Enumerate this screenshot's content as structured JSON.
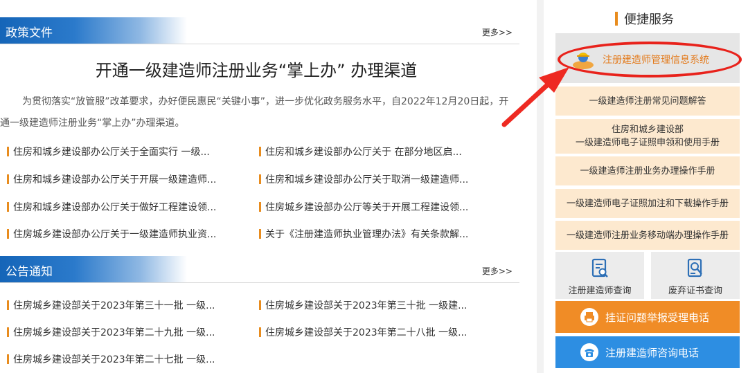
{
  "policy": {
    "section_title": "政策文件",
    "more": "更多>>",
    "headline": "开通一级建造师注册业务“掌上办” 办理渠道",
    "intro": "为贯彻落实“放管服”改革要求，办好便民惠民“关键小事”，进一步优化政务服务水平，自2022年12月20日起，开通一级建造师注册业务“掌上办”办理渠道。",
    "links": [
      "住房和城乡建设部办公厅关于全面实行 一级...",
      "住房和城乡建设部办公厅关于 在部分地区启...",
      "住房和城乡建设部办公厅关于开展一级建造师...",
      "住房和城乡建设部办公厅关于取消一级建造师...",
      "住房和城乡建设部办公厅关于做好工程建设领...",
      "住房城乡建设部办公厅等关于开展工程建设领...",
      "住房城乡建设部办公厅关于一级建造师执业资...",
      "关于《注册建造师执业管理办法》有关条款解..."
    ]
  },
  "notice": {
    "section_title": "公告通知",
    "more": "更多>>",
    "links": [
      "住房城乡建设部关于2023年第三十一批 一级...",
      "住房城乡建设部关于2023年第三十批 一级建...",
      "住房城乡建设部关于2023年第二十九批 一级...",
      "住房城乡建设部关于2023年第二十八批 一级...",
      "住房城乡建设部关于2023年第二十七批 一级..."
    ]
  },
  "sidebar": {
    "title": "便捷服务",
    "system_button": "注册建造师管理信息系统",
    "buttons": [
      "一级建造师注册常见问题解答",
      "住房和城乡建设部",
      "一级建造师电子证照申领和使用手册",
      "一级建造师注册业务办理操作手册",
      "一级建造师电子证照加注和下载操作手册",
      "一级建造师注册业务移动端办理操作手册"
    ],
    "tiles": [
      "注册建造师查询",
      "废弃证书查询"
    ],
    "report_hotline": "挂证问题举报受理电话",
    "consult_hotline": "注册建造师咨询电话",
    "colors": {
      "accent": "#e88c1e",
      "orange": "#f08c26",
      "blue": "#2d8ee2",
      "highlight": "#e8221b"
    }
  }
}
